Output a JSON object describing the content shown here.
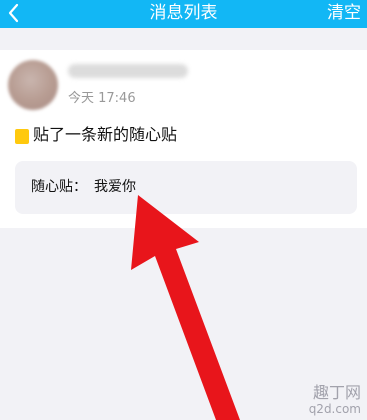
{
  "header": {
    "back_icon": "chevron-left-icon",
    "title": "消息列表",
    "action_label": "清空"
  },
  "message": {
    "time": "今天 17:46",
    "action_text": "贴了一条新的随心贴",
    "sticky_icon": "sticky-note-icon",
    "note": {
      "label": "随心贴：",
      "content": "我爱你"
    }
  },
  "colors": {
    "header_bg": "#12b7f5",
    "accent_arrow": "#e8151b",
    "sticky": "#ffc90e"
  },
  "watermark": {
    "line1": "趣丁网",
    "line2": "q2d.com"
  }
}
